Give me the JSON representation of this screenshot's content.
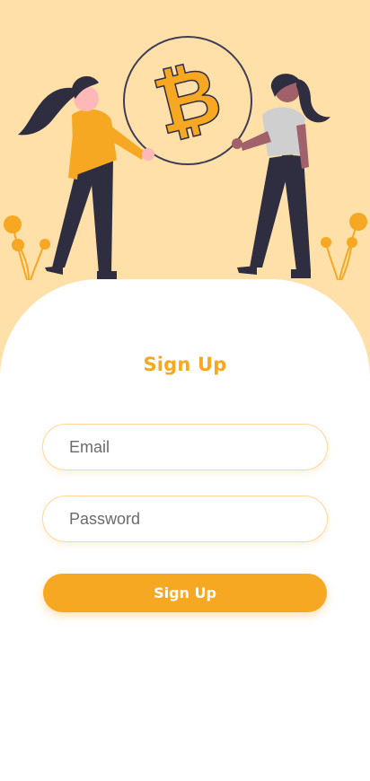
{
  "screen": {
    "title": "Sign Up"
  },
  "form": {
    "email": {
      "value": "",
      "placeholder": "Email"
    },
    "password": {
      "value": "",
      "placeholder": "Password"
    },
    "submit_label": "Sign Up"
  },
  "illustration": {
    "name": "two-people-holding-bitcoin-coin",
    "coin_icon": "bitcoin-icon"
  },
  "colors": {
    "accent": "#F7A823",
    "hero_background": "#FFE0A8",
    "figure_dark": "#2F2E41",
    "field_border": "#FFD79A"
  }
}
